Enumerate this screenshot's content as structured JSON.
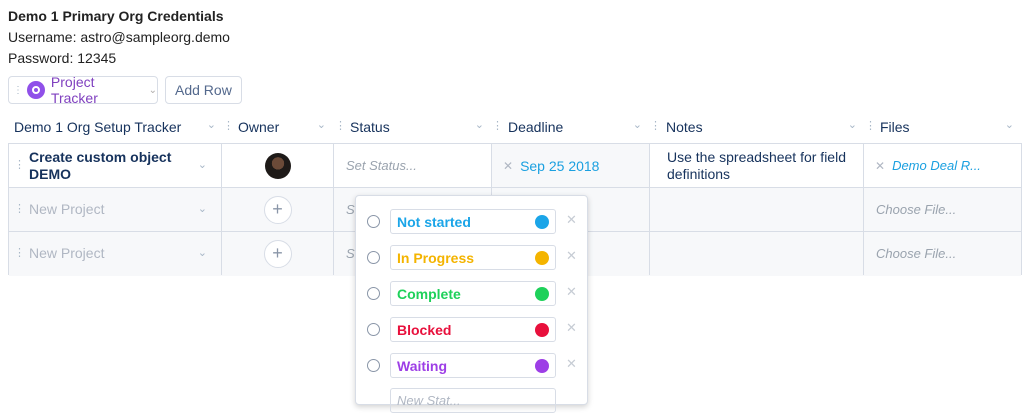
{
  "credentials": {
    "title": "Demo 1 Primary Org Credentials",
    "username": "Username: astro@sampleorg.demo",
    "password": "Password: 12345"
  },
  "toolbar": {
    "tracker_label": "Project Tracker",
    "add_row_label": "Add Row"
  },
  "columns": {
    "project": "Demo 1 Org Setup Tracker",
    "owner": "Owner",
    "status": "Status",
    "deadline": "Deadline",
    "notes": "Notes",
    "files": "Files"
  },
  "rows": [
    {
      "project": "Create custom object DEMO",
      "status_placeholder": "Set Status...",
      "deadline": "Sep 25 2018",
      "notes": "Use the spreadsheet for field definitions",
      "file": "Demo Deal R..."
    },
    {
      "project": "New Project",
      "status_partial": "S",
      "file": "Choose File..."
    },
    {
      "project": "New Project",
      "status_partial": "S",
      "file": "Choose File..."
    }
  ],
  "status_options": [
    {
      "label": "Not started",
      "color": "#1ba5e8"
    },
    {
      "label": "In Progress",
      "color": "#f4b400"
    },
    {
      "label": "Complete",
      "color": "#1ed15a"
    },
    {
      "label": "Blocked",
      "color": "#e8103c"
    },
    {
      "label": "Waiting",
      "color": "#9d3ee6"
    }
  ],
  "new_status_placeholder": "New Stat..."
}
